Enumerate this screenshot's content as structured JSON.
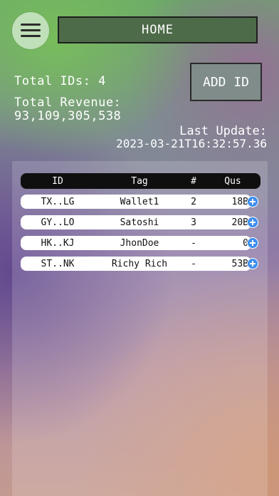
{
  "header": {
    "menu_icon": "hamburger-menu-icon",
    "home_label": "HOME"
  },
  "summary": {
    "total_ids": "Total IDs: 4",
    "revenue_label": "Total Revenue:",
    "revenue_value": "93,109,305,538",
    "last_update_label": "Last Update:",
    "last_update_value": "2023-03-21T16:32:57.36"
  },
  "actions": {
    "add_id_label": "ADD ID"
  },
  "table": {
    "headers": {
      "id": "ID",
      "tag": "Tag",
      "num": "#",
      "qus": "Qus"
    },
    "row_action_icon": "plus-circle-icon",
    "accent_color": "#3d8ef0",
    "rows": [
      {
        "id": "TX..LG",
        "tag": "Wallet1",
        "num": "2",
        "qus": "18B"
      },
      {
        "id": "GY..LO",
        "tag": "Satoshi",
        "num": "3",
        "qus": "20B"
      },
      {
        "id": "HK..KJ",
        "tag": "JhonDoe",
        "num": "-",
        "qus": "0"
      },
      {
        "id": "ST..NK",
        "tag": "Richy Rich",
        "num": "-",
        "qus": "53B"
      }
    ]
  }
}
